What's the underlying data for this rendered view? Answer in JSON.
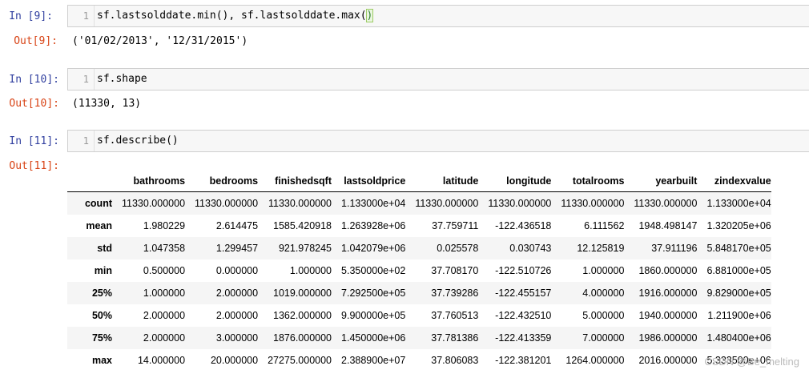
{
  "cells": [
    {
      "in_prompt": "In  [9]:",
      "line_number": "1",
      "code_before_bracket": "sf.lastsolddate.min(), sf.lastsolddate.max(",
      "code_bracket": ")",
      "out_prompt": "Out[9]:",
      "output": "('01/02/2013', '12/31/2015')"
    },
    {
      "in_prompt": "In  [10]:",
      "line_number": "1",
      "code": "sf.shape",
      "out_prompt": "Out[10]:",
      "output": "(11330, 13)"
    },
    {
      "in_prompt": "In  [11]:",
      "line_number": "1",
      "code": "sf.describe()",
      "out_prompt": "Out[11]:"
    }
  ],
  "describe_table": {
    "columns": [
      "bathrooms",
      "bedrooms",
      "finishedsqft",
      "lastsoldprice",
      "latitude",
      "longitude",
      "totalrooms",
      "yearbuilt",
      "zindexvalue"
    ],
    "rows": [
      {
        "label": "count",
        "values": [
          "11330.000000",
          "11330.000000",
          "11330.000000",
          "1.133000e+04",
          "11330.000000",
          "11330.000000",
          "11330.000000",
          "11330.000000",
          "1.133000e+04"
        ]
      },
      {
        "label": "mean",
        "values": [
          "1.980229",
          "2.614475",
          "1585.420918",
          "1.263928e+06",
          "37.759711",
          "-122.436518",
          "6.111562",
          "1948.498147",
          "1.320205e+06"
        ]
      },
      {
        "label": "std",
        "values": [
          "1.047358",
          "1.299457",
          "921.978245",
          "1.042079e+06",
          "0.025578",
          "0.030743",
          "12.125819",
          "37.911196",
          "5.848170e+05"
        ]
      },
      {
        "label": "min",
        "values": [
          "0.500000",
          "0.000000",
          "1.000000",
          "5.350000e+02",
          "37.708170",
          "-122.510726",
          "1.000000",
          "1860.000000",
          "6.881000e+05"
        ]
      },
      {
        "label": "25%",
        "values": [
          "1.000000",
          "2.000000",
          "1019.000000",
          "7.292500e+05",
          "37.739286",
          "-122.455157",
          "4.000000",
          "1916.000000",
          "9.829000e+05"
        ]
      },
      {
        "label": "50%",
        "values": [
          "2.000000",
          "2.000000",
          "1362.000000",
          "9.900000e+05",
          "37.760513",
          "-122.432510",
          "5.000000",
          "1940.000000",
          "1.211900e+06"
        ]
      },
      {
        "label": "75%",
        "values": [
          "2.000000",
          "3.000000",
          "1876.000000",
          "1.450000e+06",
          "37.781386",
          "-122.413359",
          "7.000000",
          "1986.000000",
          "1.480400e+06"
        ]
      },
      {
        "label": "max",
        "values": [
          "14.000000",
          "20.000000",
          "27275.000000",
          "2.388900e+07",
          "37.806083",
          "-122.381201",
          "1264.000000",
          "2016.000000",
          "5.333500e+06"
        ]
      }
    ]
  },
  "watermark": "CSDN @Be_melting"
}
